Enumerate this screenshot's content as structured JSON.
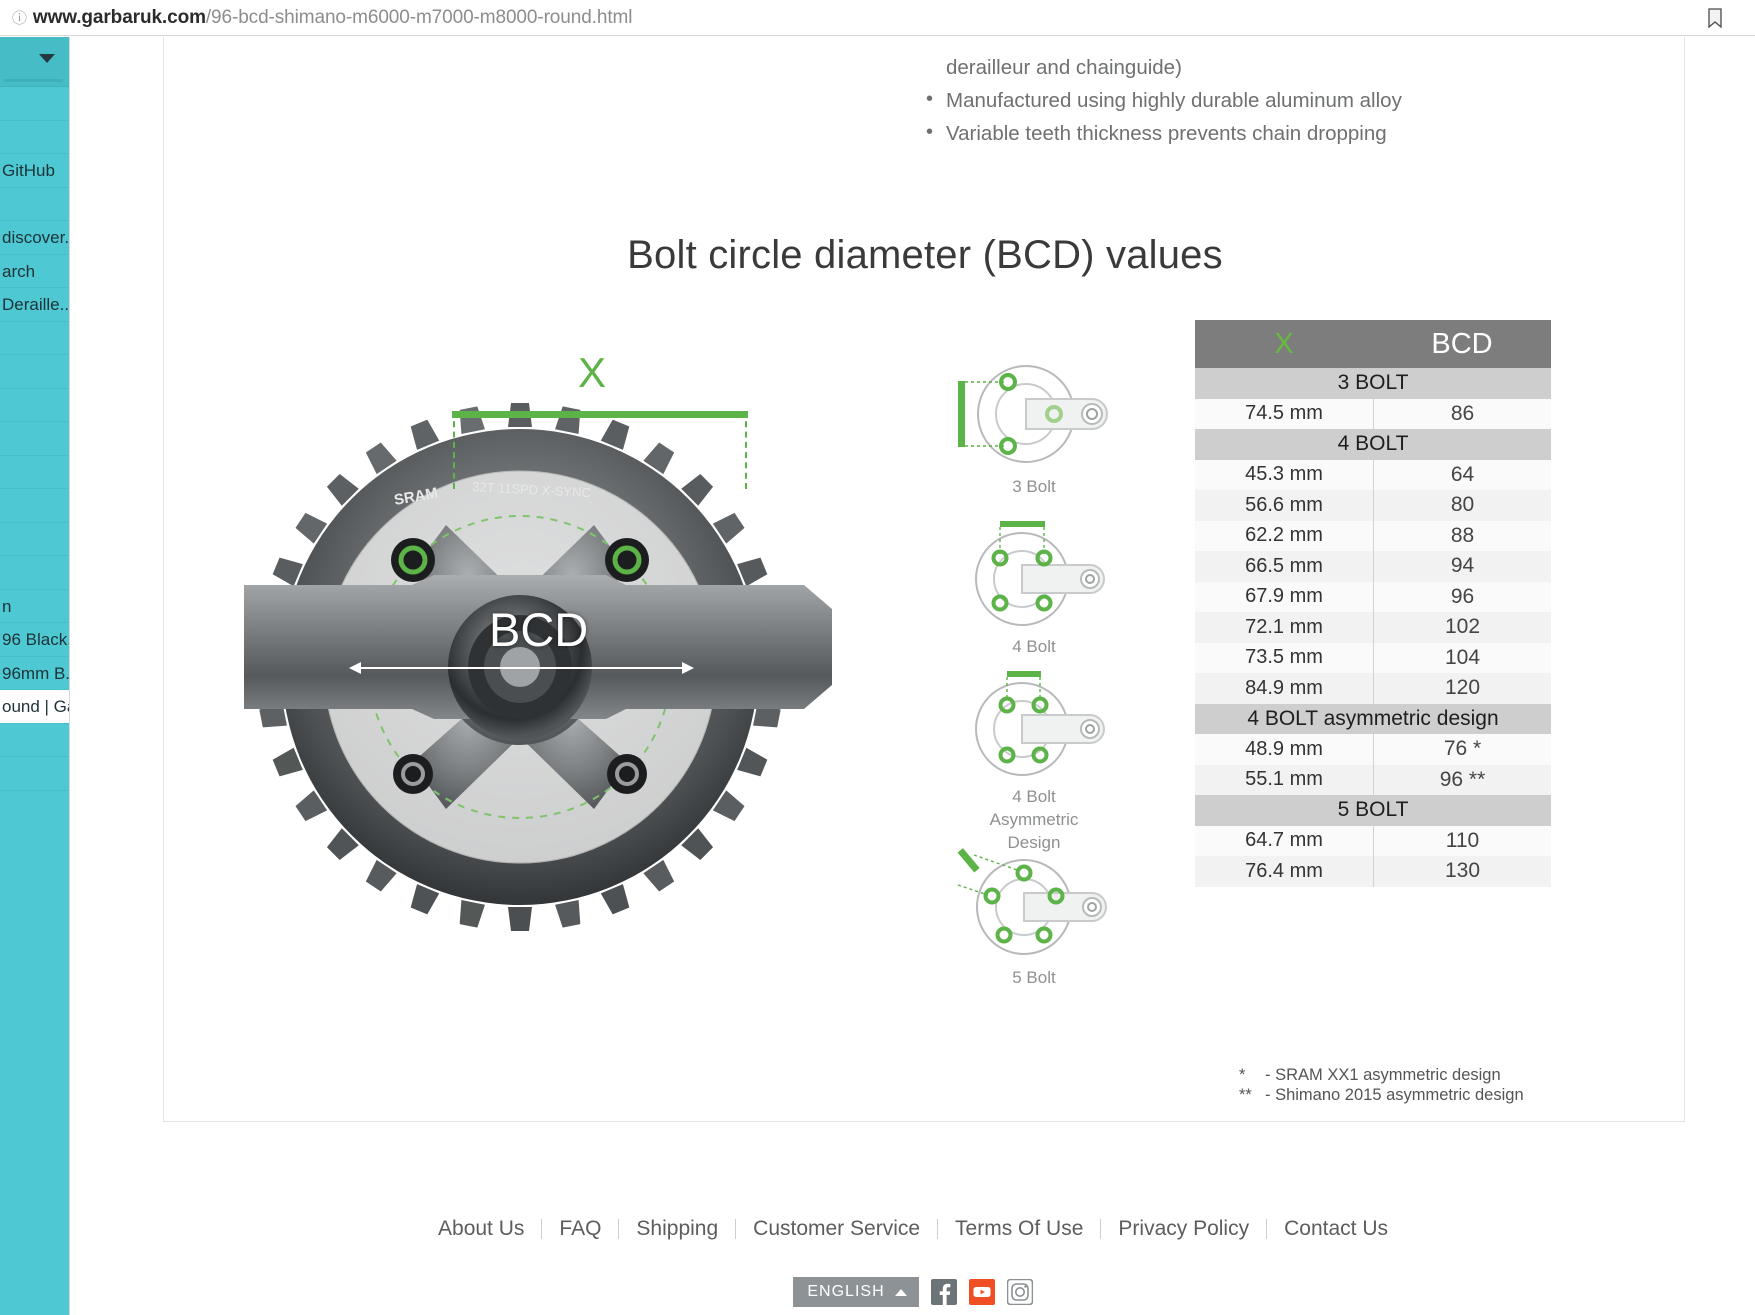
{
  "browser": {
    "url_domain": "www.garbaruk.com",
    "url_path": "/96-bcd-shimano-m6000-m7000-m8000-round.html",
    "bookmark_icon": "bookmark-icon"
  },
  "sidebar": {
    "items": [
      {
        "label": ""
      },
      {
        "label": ""
      },
      {
        "label": "GitHub"
      },
      {
        "label": ""
      },
      {
        "label": "discover..."
      },
      {
        "label": "arch"
      },
      {
        "label": "Deraille..."
      },
      {
        "label": ""
      },
      {
        "label": ""
      },
      {
        "label": ""
      },
      {
        "label": ""
      },
      {
        "label": ""
      },
      {
        "label": ""
      },
      {
        "label": ""
      },
      {
        "label": ""
      },
      {
        "label": "n"
      },
      {
        "label": "96 Black..."
      },
      {
        "label": "96mm B..."
      },
      {
        "label": "ound | Ga"
      },
      {
        "label": ""
      },
      {
        "label": ""
      }
    ],
    "active_index": 18
  },
  "product_bullets": {
    "continuation": "derailleur and chainguide)",
    "items": [
      "Manufactured using highly durable aluminum alloy",
      "Variable teeth thickness prevents chain dropping"
    ]
  },
  "section": {
    "title": "Bolt circle diameter (BCD) values"
  },
  "crank_photo": {
    "x_label": "X",
    "bcd_label": "BCD",
    "chainring_text": "SRAM  32T 11SPD X-SYNC"
  },
  "bolt_figures": [
    {
      "caption": "3 Bolt",
      "bolts": 3
    },
    {
      "caption": "4 Bolt",
      "bolts": 4
    },
    {
      "caption": "4 Bolt\nAsymmetric\nDesign",
      "caption_line1": "4 Bolt",
      "caption_line2": "Asymmetric",
      "caption_line3": "Design",
      "bolts": 4
    },
    {
      "caption": "5 Bolt",
      "bolts": 5
    }
  ],
  "chart_data": {
    "type": "table",
    "title": "Bolt circle diameter (BCD) values",
    "columns": [
      "X",
      "BCD"
    ],
    "header_x_color": "#66bb3f",
    "header_bg": "#7d7d7d",
    "groups": [
      {
        "name": "3 BOLT",
        "rows": [
          {
            "x": "74.5 mm",
            "bcd": "86"
          }
        ]
      },
      {
        "name": "4 BOLT",
        "rows": [
          {
            "x": "45.3 mm",
            "bcd": "64"
          },
          {
            "x": "56.6 mm",
            "bcd": "80"
          },
          {
            "x": "62.2 mm",
            "bcd": "88"
          },
          {
            "x": "66.5 mm",
            "bcd": "94"
          },
          {
            "x": "67.9 mm",
            "bcd": "96"
          },
          {
            "x": "72.1 mm",
            "bcd": "102"
          },
          {
            "x": "73.5 mm",
            "bcd": "104"
          },
          {
            "x": "84.9 mm",
            "bcd": "120"
          }
        ]
      },
      {
        "name": "4 BOLT asymmetric design",
        "rows": [
          {
            "x": "48.9 mm",
            "bcd": "76 *"
          },
          {
            "x": "55.1 mm",
            "bcd": "96 **"
          }
        ]
      },
      {
        "name": "5 BOLT",
        "rows": [
          {
            "x": "64.7 mm",
            "bcd": "110"
          },
          {
            "x": "76.4 mm",
            "bcd": "130"
          }
        ]
      }
    ],
    "notes": [
      {
        "marker": "*",
        "text": "- SRAM XX1 asymmetric design"
      },
      {
        "marker": "**",
        "text": "- Shimano  2015 asymmetric design"
      }
    ]
  },
  "footer": {
    "links": [
      "About Us",
      "FAQ",
      "Shipping",
      "Customer Service",
      "Terms Of Use",
      "Privacy Policy",
      "Contact Us"
    ],
    "language": "ENGLISH",
    "social": [
      "facebook-icon",
      "youtube-icon",
      "instagram-icon"
    ]
  }
}
